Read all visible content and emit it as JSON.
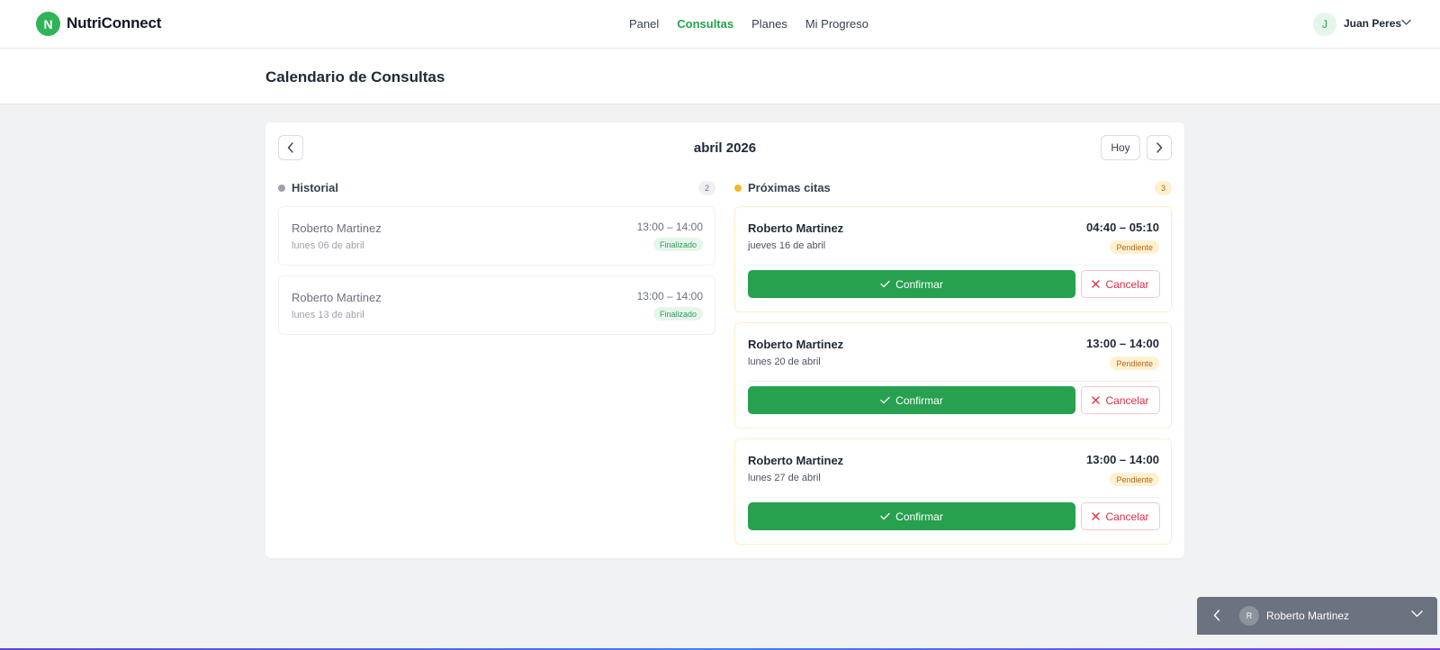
{
  "app": {
    "logo_letter": "N",
    "name": "NutriConnect"
  },
  "nav": {
    "items": [
      {
        "label": "Panel",
        "active": false
      },
      {
        "label": "Consultas",
        "active": true
      },
      {
        "label": "Planes",
        "active": false
      },
      {
        "label": "Mi Progreso",
        "active": false
      }
    ]
  },
  "user": {
    "initial": "J",
    "name": "Juan Peres"
  },
  "page": {
    "title": "Calendario de Consultas"
  },
  "calendar": {
    "month_label": "abril 2026",
    "today_label": "Hoy"
  },
  "history": {
    "title": "Historial",
    "count": "2",
    "items": [
      {
        "name": "Roberto Martinez",
        "date": "lunes 06 de abril",
        "time": "13:00 – 14:00",
        "status": "Finalizado"
      },
      {
        "name": "Roberto Martinez",
        "date": "lunes 13 de abril",
        "time": "13:00 – 14:00",
        "status": "Finalizado"
      }
    ]
  },
  "upcoming": {
    "title": "Próximas citas",
    "count": "3",
    "confirm_label": "Confirmar",
    "cancel_label": "Cancelar",
    "items": [
      {
        "name": "Roberto Martinez",
        "date": "jueves 16 de abril",
        "time": "04:40 – 05:10",
        "status": "Pendiente"
      },
      {
        "name": "Roberto Martinez",
        "date": "lunes 20 de abril",
        "time": "13:00 – 14:00",
        "status": "Pendiente"
      },
      {
        "name": "Roberto Martinez",
        "date": "lunes 27 de abril",
        "time": "13:00 – 14:00",
        "status": "Pendiente"
      }
    ]
  },
  "chat": {
    "initial": "R",
    "name": "Roberto Martinez"
  },
  "colors": {
    "brand_green": "#2fb457",
    "confirm_green": "#27a14f",
    "cancel_red": "#dc2f44",
    "pending_yellow": "#f5b82e",
    "history_gray": "#9ca3af"
  }
}
